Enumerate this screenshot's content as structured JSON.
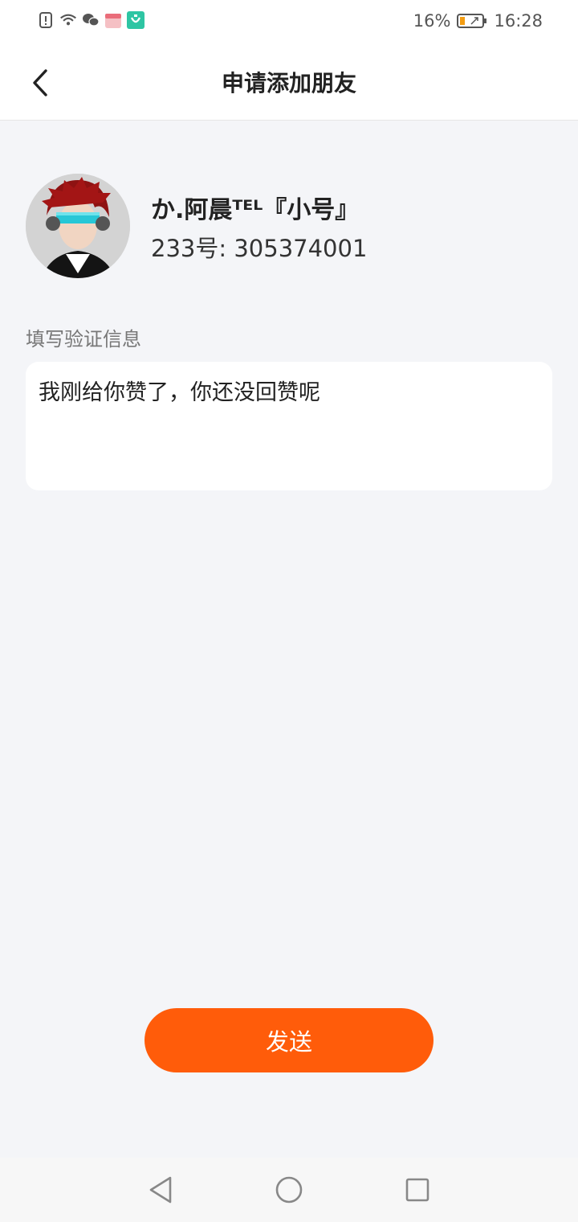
{
  "status_bar": {
    "battery_percent": "16%",
    "time": "16:28",
    "icons": [
      "alert-icon",
      "wifi-icon",
      "wechat-icon",
      "app-icon",
      "mi-home-icon"
    ]
  },
  "header": {
    "title": "申请添加朋友",
    "back_icon": "back-icon"
  },
  "profile": {
    "name": "か.阿晨ᵀᴱᴸ『小号』",
    "uid_label": "233号: 305374001"
  },
  "verification": {
    "label": "填写验证信息",
    "message": "我刚给你赞了，你还没回赞呢"
  },
  "actions": {
    "send_label": "发送"
  },
  "nav_bar": {
    "icons": [
      "nav-back-icon",
      "nav-home-icon",
      "nav-recents-icon"
    ]
  },
  "colors": {
    "accent": "#ff5c0a",
    "background": "#f4f5f8"
  }
}
